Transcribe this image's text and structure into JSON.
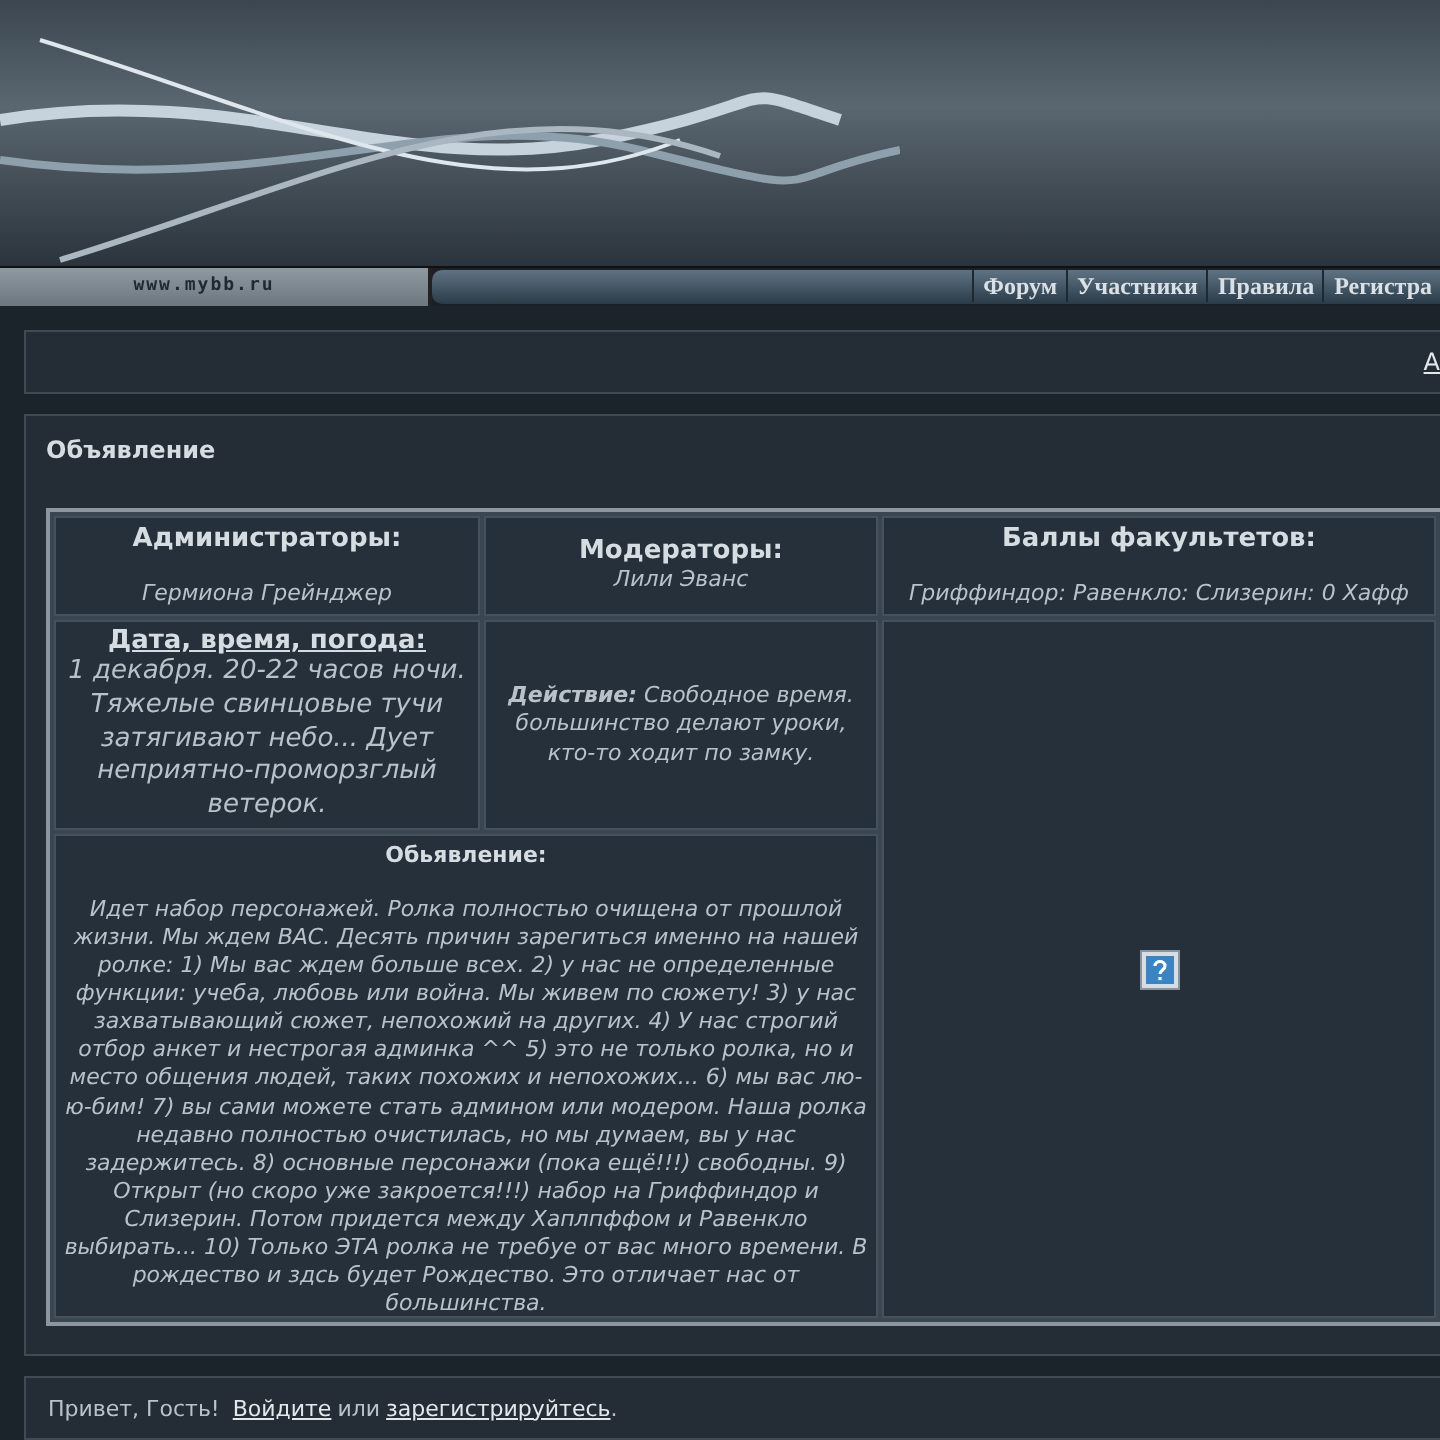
{
  "banner": {
    "site": "www.mybb.ru"
  },
  "nav": [
    {
      "label": "Форум"
    },
    {
      "label": "Участники"
    },
    {
      "label": "Правила"
    },
    {
      "label": "Регистра"
    }
  ],
  "top_panel": {
    "link": "А"
  },
  "announcement": {
    "title": "Объявление",
    "admins": {
      "heading": "Администраторы:",
      "names": "Гермиона Грейнджер"
    },
    "moderators": {
      "heading": "Модераторы:",
      "names": "Лили Эванс"
    },
    "house_points": {
      "heading": "Баллы факультетов:",
      "text": "Гриффиндор: Равенкло: Слизерин: 0 Хафф"
    },
    "datetime": {
      "heading": "Дата, время, погода:",
      "text": "1 декабря. 20-22 часов ночи. Тяжелые свинцовые тучи затягивают небо... Дует неприятно-проморзглый ветерок."
    },
    "action": {
      "text": "**Действие:** *Свободное время. большинство делают уроки, кто-то ходит по замку.*"
    },
    "notice": {
      "heading": "Обьявление:",
      "text": "Идет набор персонажей. Ролка полностью очищена от прошлой жизни. Мы ждем ВАС. Десять причин зарегиться именно на нашей ролке: 1) Мы вас ждем больше всех. 2) у нас не определенные функции: учеба, любовь или война. Мы живем по сюжету! 3) у нас захватывающий сюжет, непохожий на других. 4) У нас строгий отбор анкет и нестрогая админка ^^ 5) это не только ролка, но и место общения людей, таких похожих и непохожих... 6) мы вас лю-ю-бим! 7) вы сами можете стать админом или модером. Наша ролка недавно полностью очистилась, но мы думаем, вы у нас задержитесь. 8) основные персонажи (пока ещё!!!) свободны. 9) Открыт (но скоро уже закроется!!!) набор на Гриффиндор и Слизерин. Потом придется между Хаплпффом и Равенкло выбирать... 10) Только ЭТА ролка не требуе от вас много времени. В рождество и здсь будет Рождество. Это отличает нас от большинства."
    }
  },
  "footer": {
    "greeting": "Привет, Гость!",
    "login": "Войдите",
    "or": "или",
    "register": "зарегистрируйтесь",
    "end": "."
  }
}
